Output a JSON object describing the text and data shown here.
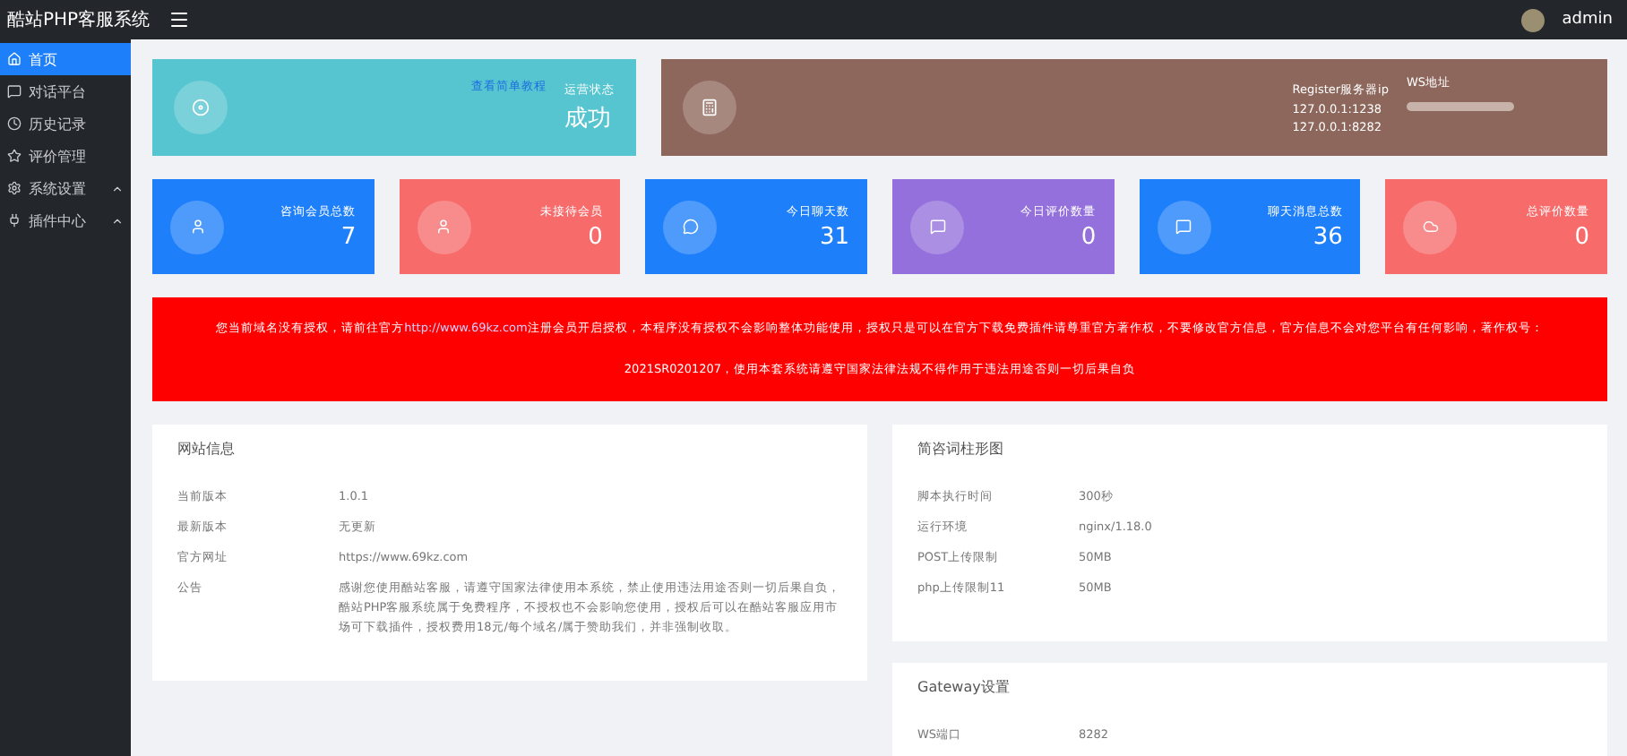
{
  "topbar": {
    "title": "酷站PHP客服系统",
    "user": "admin"
  },
  "sidebar": {
    "items": [
      {
        "label": "首页",
        "selected": true,
        "expandable": false
      },
      {
        "label": "对话平台",
        "selected": false,
        "expandable": false
      },
      {
        "label": "历史记录",
        "selected": false,
        "expandable": false
      },
      {
        "label": "评价管理",
        "selected": false,
        "expandable": false
      },
      {
        "label": "系统设置",
        "selected": false,
        "expandable": true
      },
      {
        "label": "插件中心",
        "selected": false,
        "expandable": true
      }
    ]
  },
  "status_card": {
    "link": "查看简单教程",
    "label": "运营状态",
    "value": "成功"
  },
  "server_card": {
    "register_label": "Register服务器ip",
    "register_values": [
      "127.0.0.1:1238",
      "127.0.0.1:8282"
    ],
    "ws_label": "WS地址"
  },
  "stats": [
    {
      "label": "咨询会员总数",
      "value": "7",
      "color": "#1e7ffa"
    },
    {
      "label": "未接待会员",
      "value": "0",
      "color": "#f76b6b"
    },
    {
      "label": "今日聊天数",
      "value": "31",
      "color": "#1e7ffa"
    },
    {
      "label": "今日评价数量",
      "value": "0",
      "color": "#9370db"
    },
    {
      "label": "聊天消息总数",
      "value": "36",
      "color": "#1e7ffa"
    },
    {
      "label": "总评价数量",
      "value": "0",
      "color": "#f76b6b"
    }
  ],
  "notice": {
    "before": "您当前域名没有授权，请前往官方",
    "link": "http://www.69kz.com",
    "after": "注册会员开启授权，本程序没有授权不会影响整体功能使用，授权只是可以在官方下载免费插件请尊重官方著作权，不要修改官方信息，官方信息不会对您平台有任何影响，著作权号：2021SR0201207，使用本套系统请遵守国家法律法规不得作用于违法用途否则一切后果自负"
  },
  "left_panels": [
    {
      "title": "网站信息",
      "rows": [
        {
          "label": "当前版本",
          "value": "1.0.1"
        },
        {
          "label": "最新版本",
          "value": "无更新"
        },
        {
          "label": "官方网址",
          "value": "https://www.69kz.com"
        },
        {
          "label": "公告",
          "value": "感谢您使用酷站客服，请遵守国家法律使用本系统，禁止使用违法用途否则一切后果自负，酷站PHP客服系统属于免费程序，不授权也不会影响您使用，授权后可以在酷站客服应用市场可下载插件，授权费用18元/每个域名/属于赞助我们，并非强制收取。"
        }
      ]
    }
  ],
  "right_panels": [
    {
      "title": "简咨词柱形图",
      "rows": [
        {
          "label": "脚本执行时间",
          "value": "300秒"
        },
        {
          "label": "运行环境",
          "value": "nginx/1.18.0"
        },
        {
          "label": "POST上传限制",
          "value": "50MB"
        },
        {
          "label": "php上传限制11",
          "value": "50MB"
        }
      ]
    },
    {
      "title": "Gateway设置",
      "rows": [
        {
          "label": "WS端口",
          "value": "8282"
        }
      ]
    }
  ]
}
